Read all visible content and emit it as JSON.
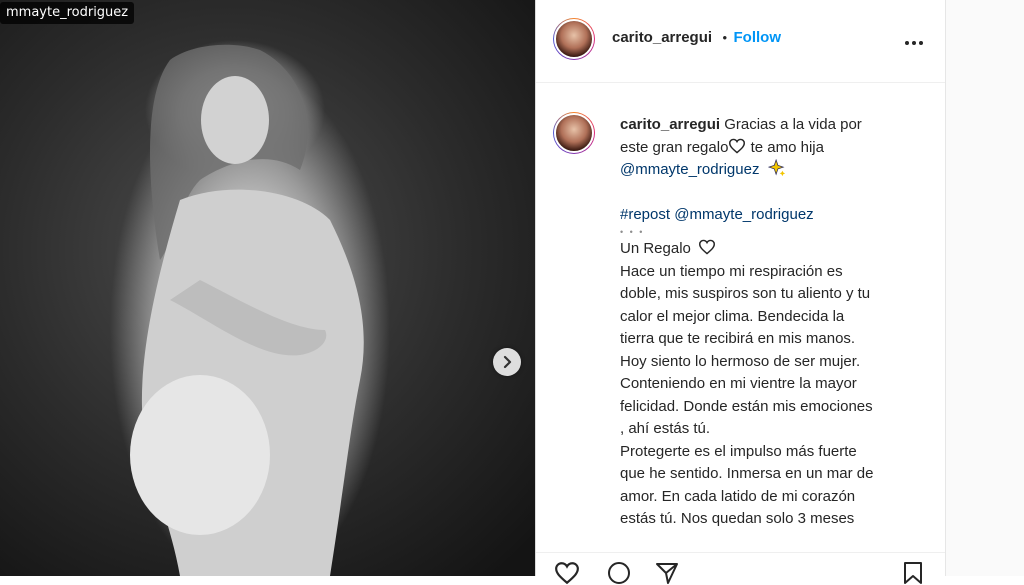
{
  "photo": {
    "username_tag": "mmayte_rodriguez"
  },
  "header": {
    "username": "carito_arregui",
    "separator": "•",
    "follow_label": "Follow",
    "more_icon": "more-dots-icon"
  },
  "caption": {
    "username": "carito_arregui",
    "line1": "Gracias a la vida por",
    "line2a": "este gran regalo",
    "line2b": " te amo hija",
    "mention1": "@mmayte_rodriguez",
    "repost_tag": "#repost",
    "repost_mention": "@mmayte_rodriguez",
    "dots": "• • •",
    "title": "Un Regalo",
    "body_lines": [
      "Hace un tiempo mi respiración es",
      "doble, mis suspiros son tu aliento y tu",
      "calor el mejor clima. Bendecida la",
      "tierra que te recibirá en mis manos.",
      "Hoy siento lo hermoso de ser mujer.",
      "Conteniendo en mi vientre la mayor",
      "felicidad. Donde están mis emociones",
      ", ahí estás tú.",
      "Protegerte es el impulso más fuerte",
      "que he sentido. Inmersa en un mar de",
      "amor. En cada latido de mi corazón",
      "estás tú. Nos quedan solo 3 meses"
    ]
  },
  "icons": {
    "heart": "heart-icon",
    "sparkle": "sparkles-icon",
    "next": "chevron-right-icon",
    "like": "like-icon",
    "comment": "comment-icon",
    "share": "share-icon",
    "save": "bookmark-icon"
  },
  "colors": {
    "accent": "#0095f6",
    "text": "#262626",
    "link": "#00376b"
  }
}
